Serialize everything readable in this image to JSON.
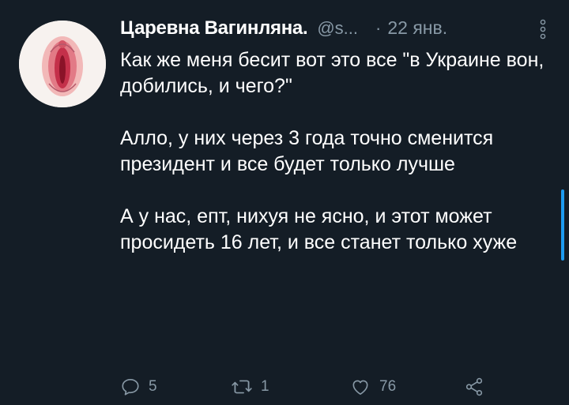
{
  "author": {
    "name": "Царевна Вагинляна.",
    "handle": "@s...",
    "separator": "·",
    "date": "22 янв."
  },
  "tweet": {
    "paragraphs": [
      "Как же меня бесит вот это все \"в Украине вон, добились, и чего?\"",
      "Алло, у них через 3 года точно сменится президент и все будет только лучше",
      "А у нас, епт, нихуя не ясно, и этот может просидеть 16 лет, и все станет только хуже"
    ]
  },
  "actions": {
    "replies": "5",
    "retweets": "1",
    "likes": "76"
  },
  "icons": {
    "more": "more-vertical-icon",
    "reply": "reply-icon",
    "retweet": "retweet-icon",
    "like": "heart-icon",
    "share": "share-icon"
  },
  "colors": {
    "background": "#141d26",
    "text": "#ffffff",
    "muted": "#8899a6",
    "accent": "#1d9bf0"
  }
}
